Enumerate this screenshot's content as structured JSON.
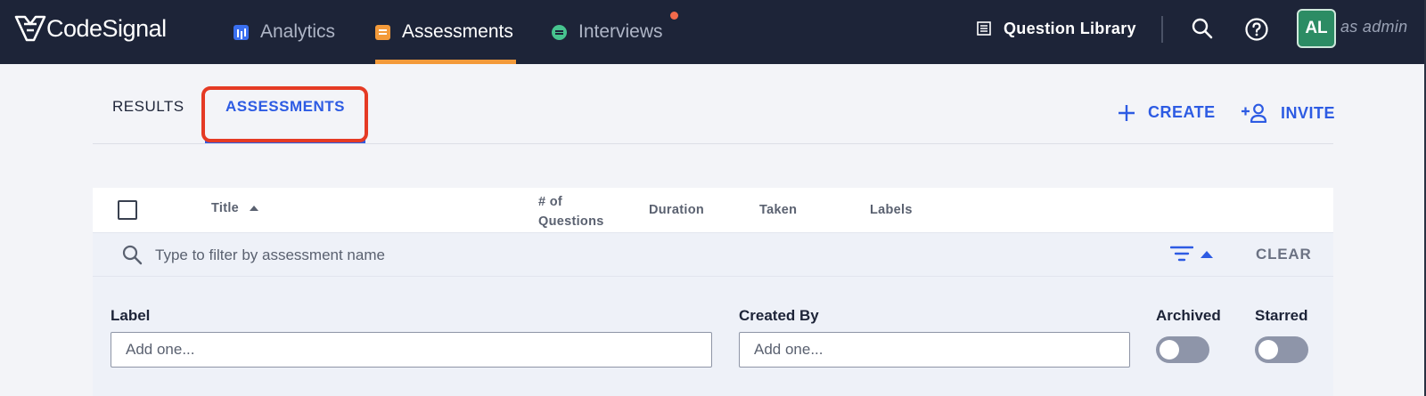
{
  "brand": {
    "name": "CodeSignal"
  },
  "nav": {
    "items": [
      {
        "label": "Analytics",
        "icon": "analytics-icon"
      },
      {
        "label": "Assessments",
        "icon": "assessments-icon",
        "active": true
      },
      {
        "label": "Interviews",
        "icon": "interviews-icon",
        "has_notification": true
      }
    ],
    "question_library": "Question Library",
    "avatar_initials": "AL",
    "user_role": "as admin",
    "accent_color": "#f39a3a"
  },
  "tabs": {
    "results": "RESULTS",
    "assessments": "ASSESSMENTS",
    "active": "assessments"
  },
  "actions": {
    "create": "CREATE",
    "invite": "INVITE"
  },
  "table": {
    "columns": {
      "title": "Title",
      "questions_line1": "# of",
      "questions_line2": "Questions",
      "duration": "Duration",
      "taken": "Taken",
      "labels": "Labels"
    },
    "sort": {
      "column": "Title",
      "direction": "ascending"
    }
  },
  "filter": {
    "search_placeholder": "Type to filter by assessment name",
    "clear_label": "CLEAR",
    "label_title": "Label",
    "label_placeholder": "Add one...",
    "created_by_title": "Created By",
    "created_by_placeholder": "Add one...",
    "archived_title": "Archived",
    "archived_on": false,
    "starred_title": "Starred",
    "starred_on": false
  },
  "colors": {
    "primary": "#2d5be3",
    "navbar": "#1d2438",
    "highlight": "#e53a24"
  }
}
